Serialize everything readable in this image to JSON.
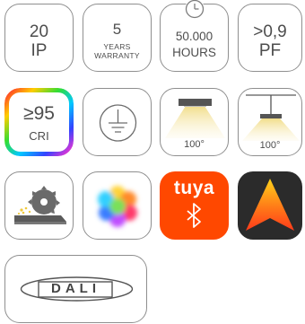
{
  "badges": {
    "ip": {
      "value": "20",
      "unit": "IP"
    },
    "warranty": {
      "value": "5",
      "line1": "YEARS",
      "line2": "WARRANTY"
    },
    "hours": {
      "value": "50.000",
      "unit": "HOURS"
    },
    "pf": {
      "value": ">0,9",
      "unit": "PF"
    },
    "cri": {
      "value": "≥95",
      "unit": "CRI"
    },
    "ground": {
      "icon": "ground-symbol-icon"
    },
    "beam_wide": {
      "angle": "100°",
      "icon": "ceiling-light-icon"
    },
    "beam_pendant": {
      "angle": "100°",
      "icon": "pendant-light-icon"
    },
    "cutting": {
      "icon": "circular-saw-icon"
    },
    "rgb": {
      "icon": "color-palette-icon"
    },
    "tuya": {
      "brand": "tuya",
      "icon": "bluetooth-icon",
      "color": "#ff4800"
    },
    "app": {
      "icon": "app-logo-icon"
    },
    "dali": {
      "text": "DALI"
    }
  }
}
